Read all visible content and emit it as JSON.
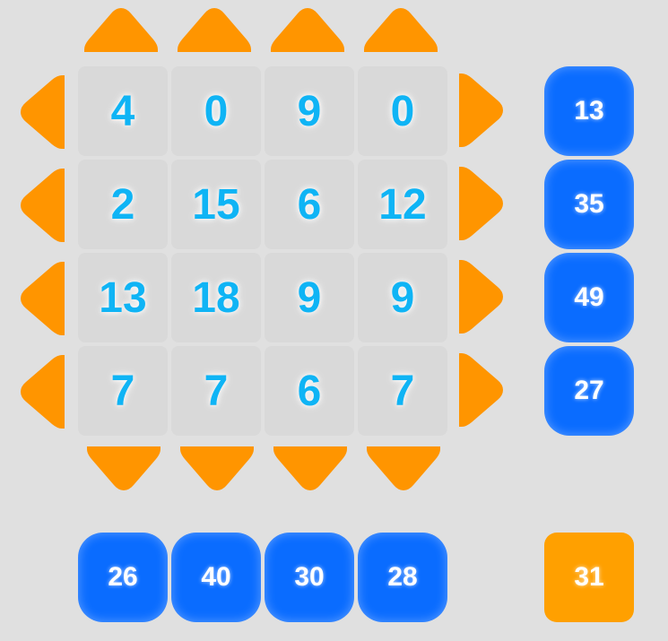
{
  "grid": {
    "rows": [
      [
        "4",
        "0",
        "9",
        "0"
      ],
      [
        "2",
        "15",
        "6",
        "12"
      ],
      [
        "13",
        "18",
        "9",
        "9"
      ],
      [
        "7",
        "7",
        "6",
        "7"
      ]
    ]
  },
  "row_sums": [
    "13",
    "35",
    "49",
    "27"
  ],
  "col_sums": [
    "26",
    "40",
    "30",
    "28"
  ],
  "target": "31",
  "colors": {
    "arrow": "#ff9500",
    "cell_bg": "#d9d9d9",
    "cell_text": "#0fb4f5",
    "sum_blue": "#0a6cff",
    "target_orange": "#ffa000",
    "background": "#e0e0e0"
  }
}
